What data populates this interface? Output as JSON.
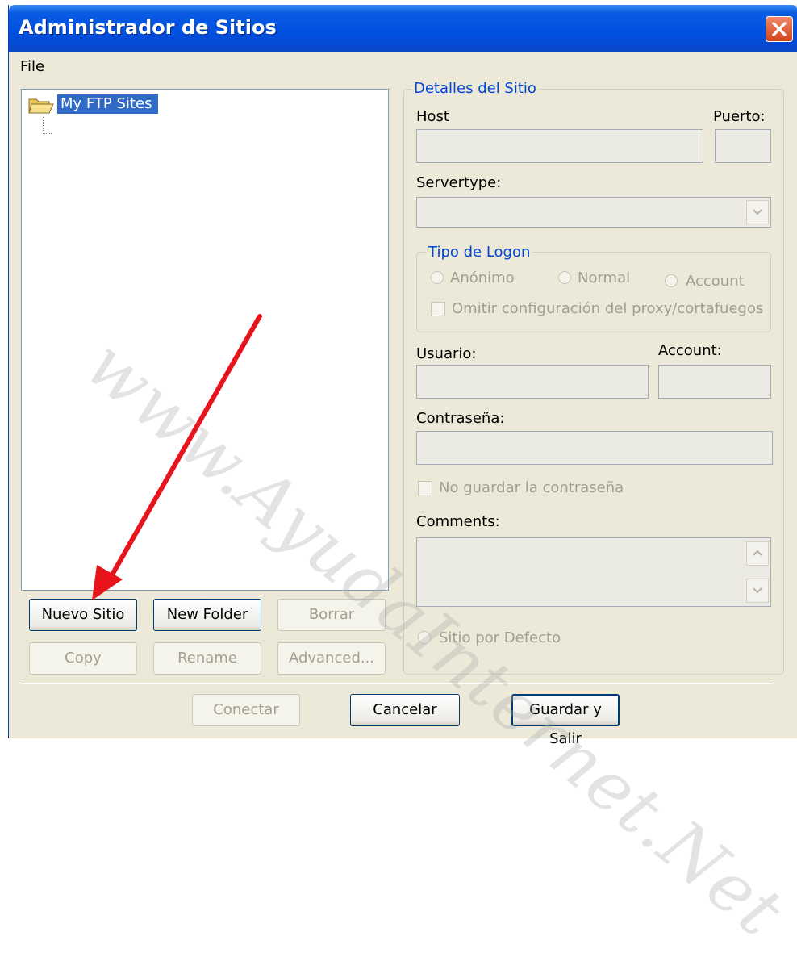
{
  "window": {
    "title": "Administrador de Sitios"
  },
  "menu": {
    "file": "File"
  },
  "tree": {
    "root_label": "My FTP Sites"
  },
  "buttons": {
    "new_site": "Nuevo Sitio",
    "new_folder": "New Folder",
    "delete": "Borrar",
    "copy": "Copy",
    "rename": "Rename",
    "advanced": "Advanced...",
    "connect": "Conectar",
    "cancel": "Cancelar",
    "save_exit": "Guardar y Salir"
  },
  "details": {
    "legend": "Detalles del Sitio",
    "host_label": "Host",
    "port_label": "Puerto:",
    "servertype_label": "Servertype:",
    "logon": {
      "legend": "Tipo de Logon",
      "anonymous": "Anónimo",
      "normal": "Normal",
      "account": "Account",
      "bypass_proxy": "Omitir configuración del proxy/cortafuegos"
    },
    "user_label": "Usuario:",
    "account_label": "Account:",
    "password_label": "Contraseña:",
    "dont_save_password": "No guardar la contraseña",
    "comments_label": "Comments:",
    "default_site": "Sitio por Defecto"
  },
  "watermark": "www.AyudaInternet.Net",
  "colors": {
    "title_bar": "#0050e0",
    "selection": "#316ac5",
    "group_legend": "#0046d5",
    "arrow": "#e8141c"
  }
}
